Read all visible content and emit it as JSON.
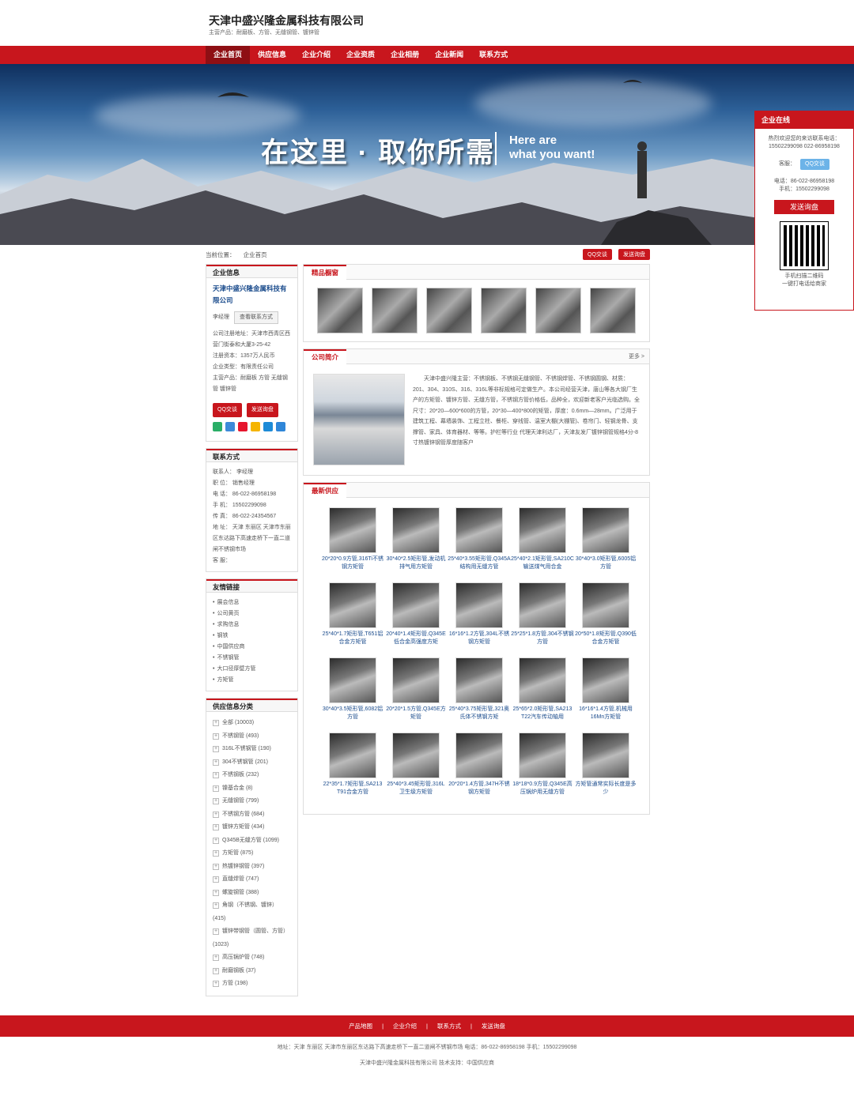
{
  "header": {
    "company": "天津中盛兴隆金属科技有限公司",
    "products": "主营产品：耐磨板、方管、无缝钢管、镀锌管"
  },
  "nav": [
    "企业首页",
    "供应信息",
    "企业介绍",
    "企业资质",
    "企业相册",
    "企业新闻",
    "联系方式"
  ],
  "banner": {
    "zh": "在这里 · 取你所需",
    "en1": "Here are",
    "en2": "what you want!"
  },
  "crumb": {
    "label": "当前位置：",
    "page": "企业首页",
    "qq": "QQ交谈",
    "inquiry": "发送询盘"
  },
  "info": {
    "title": "企业信息",
    "name": "天津中盛兴隆金属科技有限公司",
    "person": "李经理",
    "view": "查看联系方式",
    "addr": "公司注册地址：天津市西青区西营门街泰和大厦3-25-42",
    "capital": "注册资本：1357万人民币",
    "type": "企业类型：有限责任公司",
    "main": "主营产品：耐磨板 方管 无缝钢管 镀锌管",
    "qq": "QQ交谈",
    "inquiry": "发送询盘"
  },
  "contact": {
    "title": "联系方式",
    "rows": [
      "联系人：  李经理",
      "职 位：  销售经理",
      "电 话：  86-022-86958198",
      "手 机：  15502299098",
      "传 真：  86-022-24354567",
      "地 址：  天津 东丽区 天津市东丽区东达路下高速走桥下一直二道闸不锈钢市场",
      "客 服："
    ]
  },
  "links": {
    "title": "友情链接",
    "items": [
      "展会信息",
      "公司黄页",
      "求购信息",
      "钢铁",
      "中国供应商",
      "不锈钢管",
      "大口径厚壁方管",
      "方矩管"
    ]
  },
  "cats": {
    "title": "供应信息分类",
    "items": [
      "全部 (10003)",
      "不锈钢管 (493)",
      "316L不锈钢管 (190)",
      "304不锈钢管 (201)",
      "不锈钢板 (232)",
      "镍基合金 (8)",
      "无缝钢管 (799)",
      "不锈钢方管 (684)",
      "镀锌方矩管 (434)",
      "Q345B无缝方管 (1099)",
      "方矩管 (875)",
      "热镀锌钢管 (397)",
      "直缝焊管 (747)",
      "螺旋钢管 (388)",
      "角钢（不锈钢、镀锌） (415)",
      "镀锌带钢管（圆管、方管） (1023)",
      "高压锅炉管 (748)",
      "耐磨钢板 (37)",
      "方管 (198)"
    ]
  },
  "showcase": {
    "title": "精品橱窗"
  },
  "intro": {
    "title": "公司简介",
    "more": "更多 >",
    "text": "天津中盛兴隆主营：不锈钢板、不锈钢无缝钢管、不锈钢焊管、不锈钢圆钢、材质：201、304、310S、316、316L等非标规格可定做生产。本公司经营天津，唐山等各大钢厂生产的方矩管、镀锌方管、无缝方管，不锈钢方管价格低，品种全，欢迎新老客户光临选购。全尺寸：20*20—600*600的方管，20*30—400*800的矩管，厚度：0.6mm—28mm。广泛用于建筑工程、幕墙装饰、工程立柱、餐柜、穿线管、温室大棚(大棚管)、卷帘门、轻钢龙骨、支撑管、家具、体育器材、等等。护栏等行业 代理天津利达厂，天津友发厂镀锌钢管规格4分-8寸热镀锌钢管厚度随客户"
  },
  "latest": {
    "title": "最新供应",
    "items": [
      "20*20*0.9方管,316Ti不锈钢方矩管",
      "30*40*2.5矩形管,发动机排气用方矩管",
      "25*40*3.55矩形管,Q345A结构用无缝方管",
      "25*40*2.1矩形管,SA210C输送煤气用合金",
      "30*40*3.0矩形管,6005铝方管",
      "25*40*1.7矩形管,T651铝合金方矩管",
      "20*40*1.4矩形管,Q345E低合金高强度方矩",
      "16*16*1.2方管,304L不锈钢方矩管",
      "25*25*1.8方管,304不锈钢方管",
      "20*50*1.8矩形管,Q390低合金方矩管",
      "30*40*3.5矩形管,6082铝方管",
      "20*20*1.5方管,Q345E方矩管",
      "25*40*3.75矩形管,321奥氏体不锈钢方矩",
      "25*65*2.0矩形管,SA213 T22汽车传动轴用",
      "16*16*1.4方管,机械用16Mn方矩管",
      "22*35*1.7矩形管,SA213 T91合金方管",
      "25*40*3.45矩形管,316L卫生级方矩管",
      "20*20*1.4方管,347H不锈钢方矩管",
      "18*18*0.9方管,Q345E高压锅炉用无缝方管",
      "方矩管通常实际长度是多少"
    ]
  },
  "float": {
    "title": "企业在线",
    "welcome": "热烈欢迎您的来访联系电话：",
    "tel1": "15502299098 022-86958198",
    "cs": "客服：",
    "qq": "QQ交谈",
    "phone": "电话：86-022-86958198",
    "mobile": "手机：15502299098",
    "send": "发送询盘",
    "scan1": "手机扫描二维码",
    "scan2": "一键打电话给商家"
  },
  "footer": {
    "links": [
      "产品地图",
      "企业介绍",
      "联系方式",
      "发送询盘"
    ],
    "addr": "地址：天津 东丽区 天津市东丽区东达路下高速走桥下一直二道闸不锈钢市场 电话：86-022-86958198 手机：15502299098",
    "copy": "天津中盛兴隆金属科技有限公司  技术支持：中国供应商"
  }
}
